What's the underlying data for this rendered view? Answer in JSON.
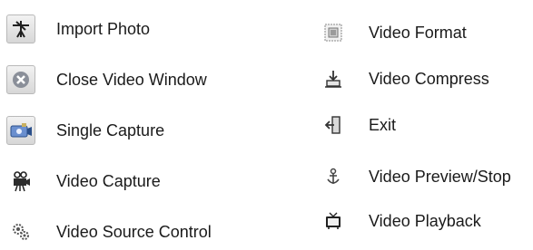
{
  "left_column": [
    {
      "label": "Import Photo",
      "icon": "import-photo-icon"
    },
    {
      "label": "Close Video Window",
      "icon": "close-video-window-icon"
    },
    {
      "label": "Single Capture",
      "icon": "single-capture-icon"
    },
    {
      "label": "Video Capture",
      "icon": "video-capture-icon"
    },
    {
      "label": "Video Source Control",
      "icon": "video-source-control-icon"
    }
  ],
  "right_column": [
    {
      "label": "Video Format",
      "icon": "video-format-icon"
    },
    {
      "label": "Video Compress",
      "icon": "video-compress-icon"
    },
    {
      "label": "Exit",
      "icon": "exit-icon"
    },
    {
      "label": "Video Preview/Stop",
      "icon": "video-preview-stop-icon"
    },
    {
      "label": "Video Playback",
      "icon": "video-playback-icon"
    }
  ]
}
